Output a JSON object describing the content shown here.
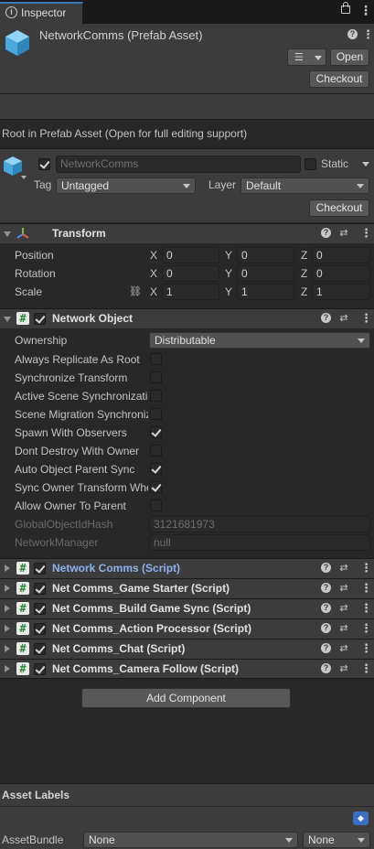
{
  "tab": {
    "title": "Inspector"
  },
  "asset": {
    "name": "NetworkComms (Prefab Asset)",
    "open_label": "Open",
    "checkout_label": "Checkout"
  },
  "prefab_notice": "Root in Prefab Asset (Open for full editing support)",
  "gameobject": {
    "name": "NetworkComms",
    "static_label": "Static",
    "tag_label": "Tag",
    "tag_value": "Untagged",
    "layer_label": "Layer",
    "layer_value": "Default",
    "checkout_label": "Checkout"
  },
  "transform": {
    "title": "Transform",
    "rows": [
      {
        "label": "Position",
        "x": "0",
        "y": "0",
        "z": "0"
      },
      {
        "label": "Rotation",
        "x": "0",
        "y": "0",
        "z": "0"
      },
      {
        "label": "Scale",
        "x": "1",
        "y": "1",
        "z": "1"
      }
    ],
    "axes": {
      "x": "X",
      "y": "Y",
      "z": "Z"
    }
  },
  "network_object": {
    "title": "Network Object",
    "ownership_label": "Ownership",
    "ownership_value": "Distributable",
    "toggles": [
      {
        "label": "Always Replicate As Root",
        "checked": false
      },
      {
        "label": "Synchronize Transform",
        "checked": false
      },
      {
        "label": "Active Scene Synchronization",
        "checked": false
      },
      {
        "label": "Scene Migration Synchronization",
        "checked": false
      },
      {
        "label": "Spawn With Observers",
        "checked": true
      },
      {
        "label": "Dont Destroy With Owner",
        "checked": false
      },
      {
        "label": "Auto Object Parent Sync",
        "checked": true
      },
      {
        "label": "Sync Owner Transform When Parented",
        "checked": true
      },
      {
        "label": "Allow Owner To Parent",
        "checked": false
      }
    ],
    "hash_label": "GlobalObjectIdHash",
    "hash_value": "3121681973",
    "manager_label": "NetworkManager",
    "manager_value": "null"
  },
  "scripts": [
    {
      "title": "Network Comms (Script)",
      "highlight": true
    },
    {
      "title": "Net Comms_Game Starter (Script)",
      "highlight": false
    },
    {
      "title": "Net Comms_Build Game Sync (Script)",
      "highlight": false
    },
    {
      "title": "Net Comms_Action Processor (Script)",
      "highlight": false
    },
    {
      "title": "Net Comms_Chat (Script)",
      "highlight": false
    },
    {
      "title": "Net Comms_Camera Follow (Script)",
      "highlight": false
    }
  ],
  "add_component_label": "Add Component",
  "asset_labels": {
    "title": "Asset Labels",
    "bundle_label": "AssetBundle",
    "bundle_value": "None",
    "variant_value": "None"
  },
  "colors": {
    "highlight_title": "#8fb0ec",
    "check_green": "#2d8a3a",
    "cube_blue": "#5fb9e6"
  }
}
